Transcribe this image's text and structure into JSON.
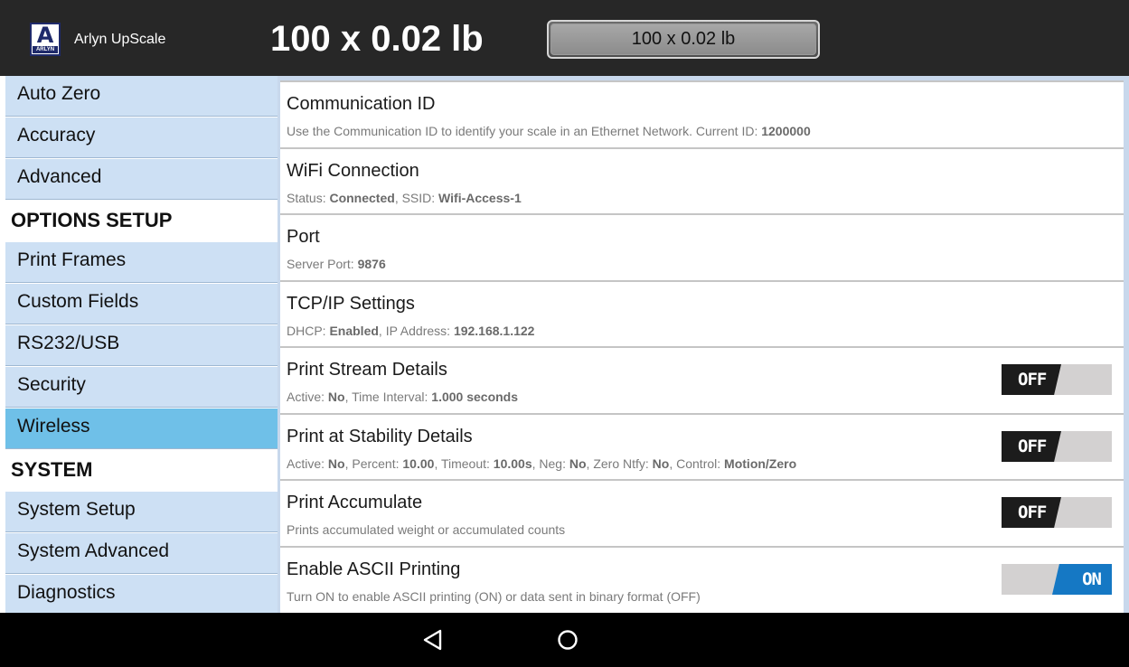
{
  "header": {
    "app_name": "Arlyn UpScale",
    "logo_letter": "A",
    "logo_text": "ARLYN",
    "weight_display": "100 x 0.02 lb",
    "weight_box": "100 x 0.02 lb"
  },
  "sidebar": {
    "items": [
      {
        "label": "Auto Zero",
        "type": "item"
      },
      {
        "label": "Accuracy",
        "type": "item"
      },
      {
        "label": "Advanced",
        "type": "item"
      },
      {
        "label": "OPTIONS SETUP",
        "type": "header"
      },
      {
        "label": "Print Frames",
        "type": "item"
      },
      {
        "label": "Custom Fields",
        "type": "item"
      },
      {
        "label": "RS232/USB",
        "type": "item"
      },
      {
        "label": "Security",
        "type": "item"
      },
      {
        "label": "Wireless",
        "type": "item",
        "selected": true
      },
      {
        "label": "SYSTEM",
        "type": "header"
      },
      {
        "label": "System Setup",
        "type": "item"
      },
      {
        "label": "System Advanced",
        "type": "item"
      },
      {
        "label": "Diagnostics",
        "type": "item"
      }
    ]
  },
  "settings": [
    {
      "title": "Communication ID",
      "desc": [
        {
          "t": "Use the Communication ID to identify your scale in an Ethernet Network. Current ID: "
        },
        {
          "t": "1200000",
          "b": true
        }
      ]
    },
    {
      "title": "WiFi Connection",
      "desc": [
        {
          "t": "Status: "
        },
        {
          "t": "Connected",
          "b": true
        },
        {
          "t": ", SSID: "
        },
        {
          "t": "Wifi-Access-1",
          "b": true
        }
      ]
    },
    {
      "title": "Port",
      "desc": [
        {
          "t": "Server Port: "
        },
        {
          "t": "9876",
          "b": true
        }
      ]
    },
    {
      "title": "TCP/IP Settings",
      "desc": [
        {
          "t": "DHCP: "
        },
        {
          "t": "Enabled",
          "b": true
        },
        {
          "t": ", IP Address: "
        },
        {
          "t": "192.168.1.122",
          "b": true
        }
      ]
    },
    {
      "title": "Print Stream Details",
      "toggle": "OFF",
      "desc": [
        {
          "t": "Active: "
        },
        {
          "t": "No",
          "b": true
        },
        {
          "t": ", Time Interval: "
        },
        {
          "t": "1.000 seconds",
          "b": true
        }
      ]
    },
    {
      "title": "Print at Stability Details",
      "toggle": "OFF",
      "desc": [
        {
          "t": "Active: "
        },
        {
          "t": "No",
          "b": true
        },
        {
          "t": ", Percent: "
        },
        {
          "t": "10.00",
          "b": true
        },
        {
          "t": ", Timeout: "
        },
        {
          "t": "10.00s",
          "b": true
        },
        {
          "t": ", Neg: "
        },
        {
          "t": "No",
          "b": true
        },
        {
          "t": ", Zero Ntfy: "
        },
        {
          "t": "No",
          "b": true
        },
        {
          "t": ", Control: "
        },
        {
          "t": "Motion/Zero",
          "b": true
        }
      ]
    },
    {
      "title": "Print Accumulate",
      "toggle": "OFF",
      "desc": [
        {
          "t": "Prints accumulated weight or accumulated counts"
        }
      ]
    },
    {
      "title": "Enable ASCII Printing",
      "toggle": "ON",
      "desc": [
        {
          "t": "Turn ON to enable ASCII printing (ON) or data sent in binary format (OFF)"
        }
      ]
    }
  ],
  "navbar": {
    "icons": [
      "back-icon",
      "home-icon"
    ]
  },
  "colors": {
    "header_bg": "#272727",
    "sidebar_item_bg": "#cde0f4",
    "sidebar_selected_bg": "#6fc0e8",
    "toggle_off_dark": "#1c1c1c",
    "toggle_on_blue": "#1578c4",
    "toggle_track": "#d3d1d1"
  }
}
